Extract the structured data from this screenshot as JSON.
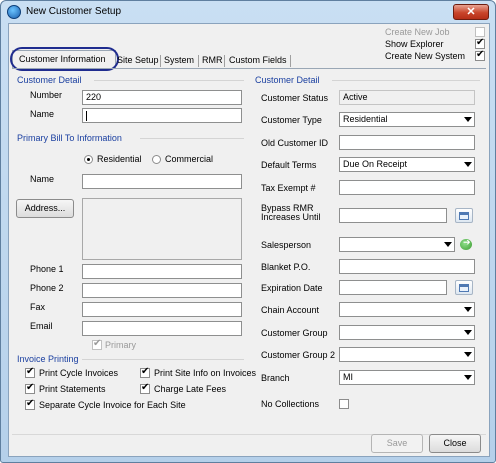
{
  "window": {
    "title": "New Customer Setup",
    "close_glyph": "✕"
  },
  "top_options": [
    {
      "label": "Create New Job",
      "checked": false,
      "disabled": true
    },
    {
      "label": "Show Explorer",
      "checked": true,
      "disabled": false
    },
    {
      "label": "Create New System",
      "checked": true,
      "disabled": false
    }
  ],
  "tabs": [
    "Customer Information",
    "Site Setup",
    "System",
    "RMR",
    "Custom Fields"
  ],
  "left": {
    "customer_detail_title": "Customer Detail",
    "number_label": "Number",
    "number_value": "220",
    "name_label": "Name",
    "name_value": "",
    "bill_to_title": "Primary Bill To Information",
    "radio_residential": "Residential",
    "radio_commercial": "Commercial",
    "bill_name_label": "Name",
    "address_button": "Address...",
    "phone1_label": "Phone 1",
    "phone2_label": "Phone 2",
    "fax_label": "Fax",
    "email_label": "Email",
    "primary_label": "Primary",
    "invoice_title": "Invoice Printing",
    "print_cycle": "Print Cycle Invoices",
    "print_site_info": "Print Site Info on Invoices",
    "print_statements": "Print Statements",
    "charge_late_fees": "Charge Late Fees",
    "separate_cycle": "Separate Cycle Invoice for Each Site"
  },
  "right": {
    "customer_detail_title": "Customer Detail",
    "status_label": "Customer Status",
    "status_value": "Active",
    "type_label": "Customer Type",
    "type_value": "Residential",
    "old_id_label": "Old Customer ID",
    "terms_label": "Default Terms",
    "terms_value": "Due On Receipt",
    "tax_label": "Tax Exempt #",
    "bypass_label_1": "Bypass RMR",
    "bypass_label_2": "Increases Until",
    "salesperson_label": "Salesperson",
    "blanket_label": "Blanket P.O.",
    "expiration_label": "Expiration Date",
    "chain_label": "Chain Account",
    "group_label": "Customer Group",
    "group2_label": "Customer Group 2",
    "branch_label": "Branch",
    "branch_value": "MI",
    "no_collections_label": "No Collections"
  },
  "buttons": {
    "save": "Save",
    "close": "Close"
  }
}
